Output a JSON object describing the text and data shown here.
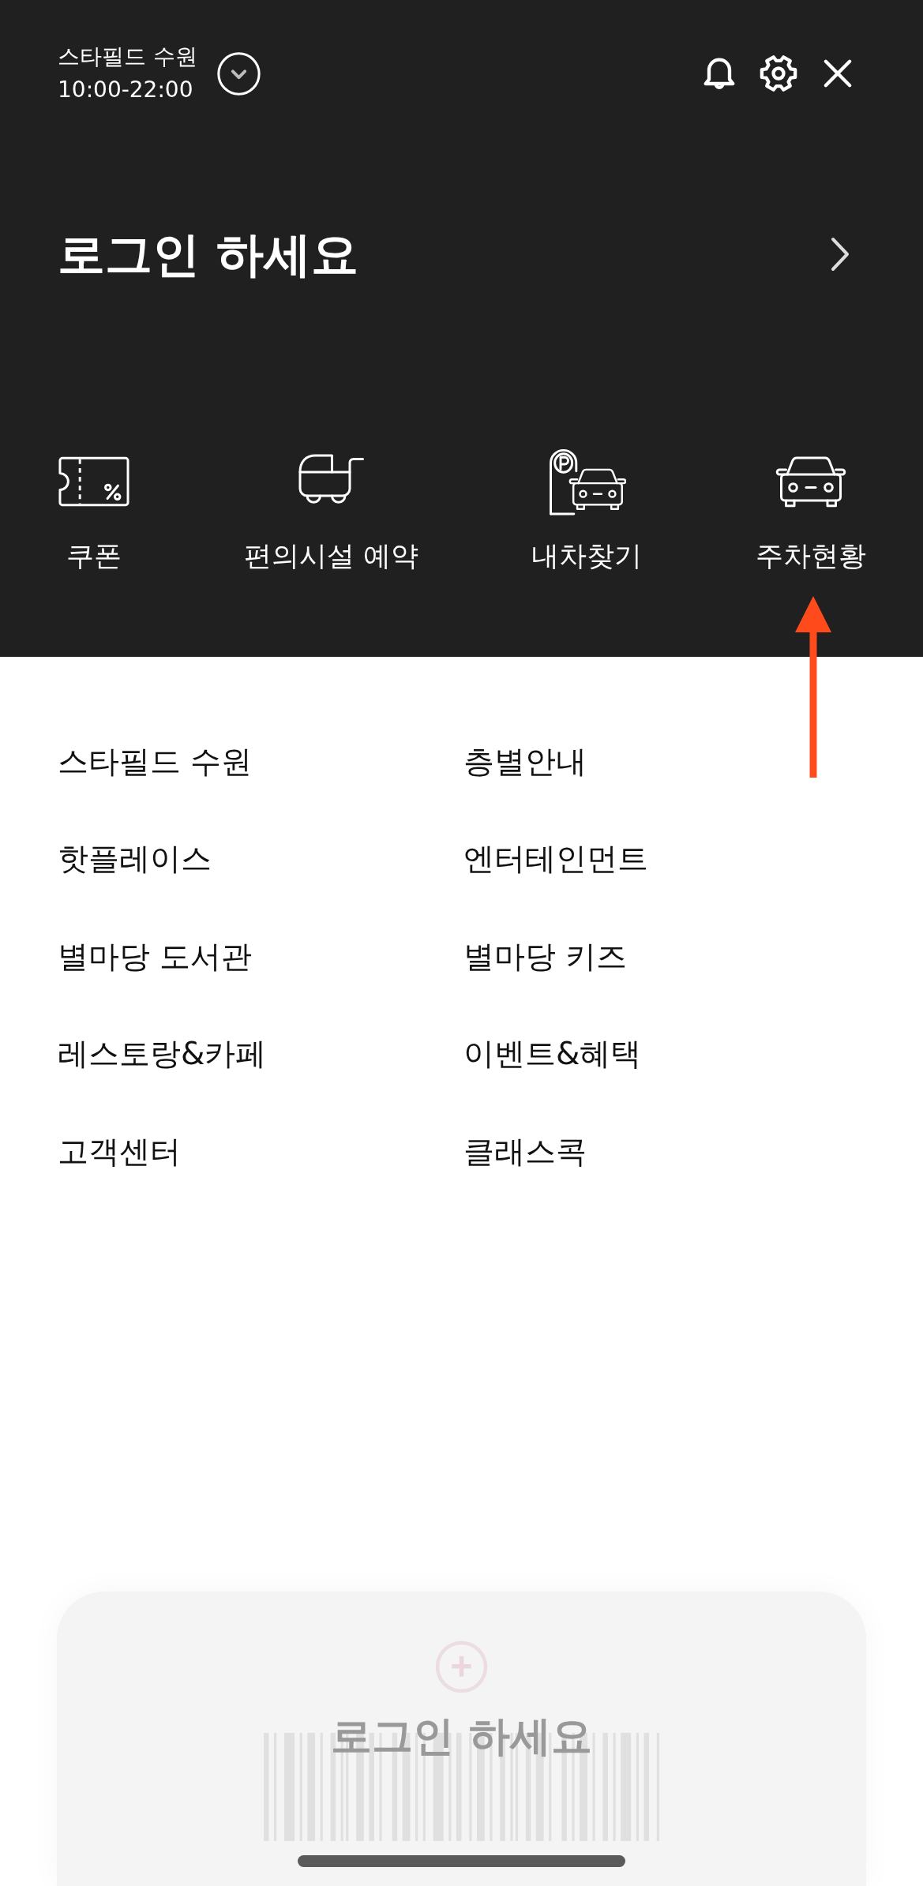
{
  "top_bar": {
    "store_name": "스타필드 수원",
    "hours": "10:00-22:00"
  },
  "header": {
    "login_prompt": "로그인 하세요"
  },
  "quick_menu": [
    {
      "label": "쿠폰",
      "kind": "coupon"
    },
    {
      "label": "편의시설 예약",
      "kind": "stroller"
    },
    {
      "label": "내차찾기",
      "kind": "parking"
    },
    {
      "label": "주차현황",
      "kind": "car"
    }
  ],
  "menu_items": [
    "스타필드 수원",
    "층별안내",
    "핫플레이스",
    "엔터테인먼트",
    "별마당 도서관",
    "별마당 키즈",
    "레스토랑&카페",
    "이벤트&혜택",
    "고객센터",
    "클래스콕"
  ],
  "membership_card": {
    "prompt": "로그인 하세요"
  }
}
